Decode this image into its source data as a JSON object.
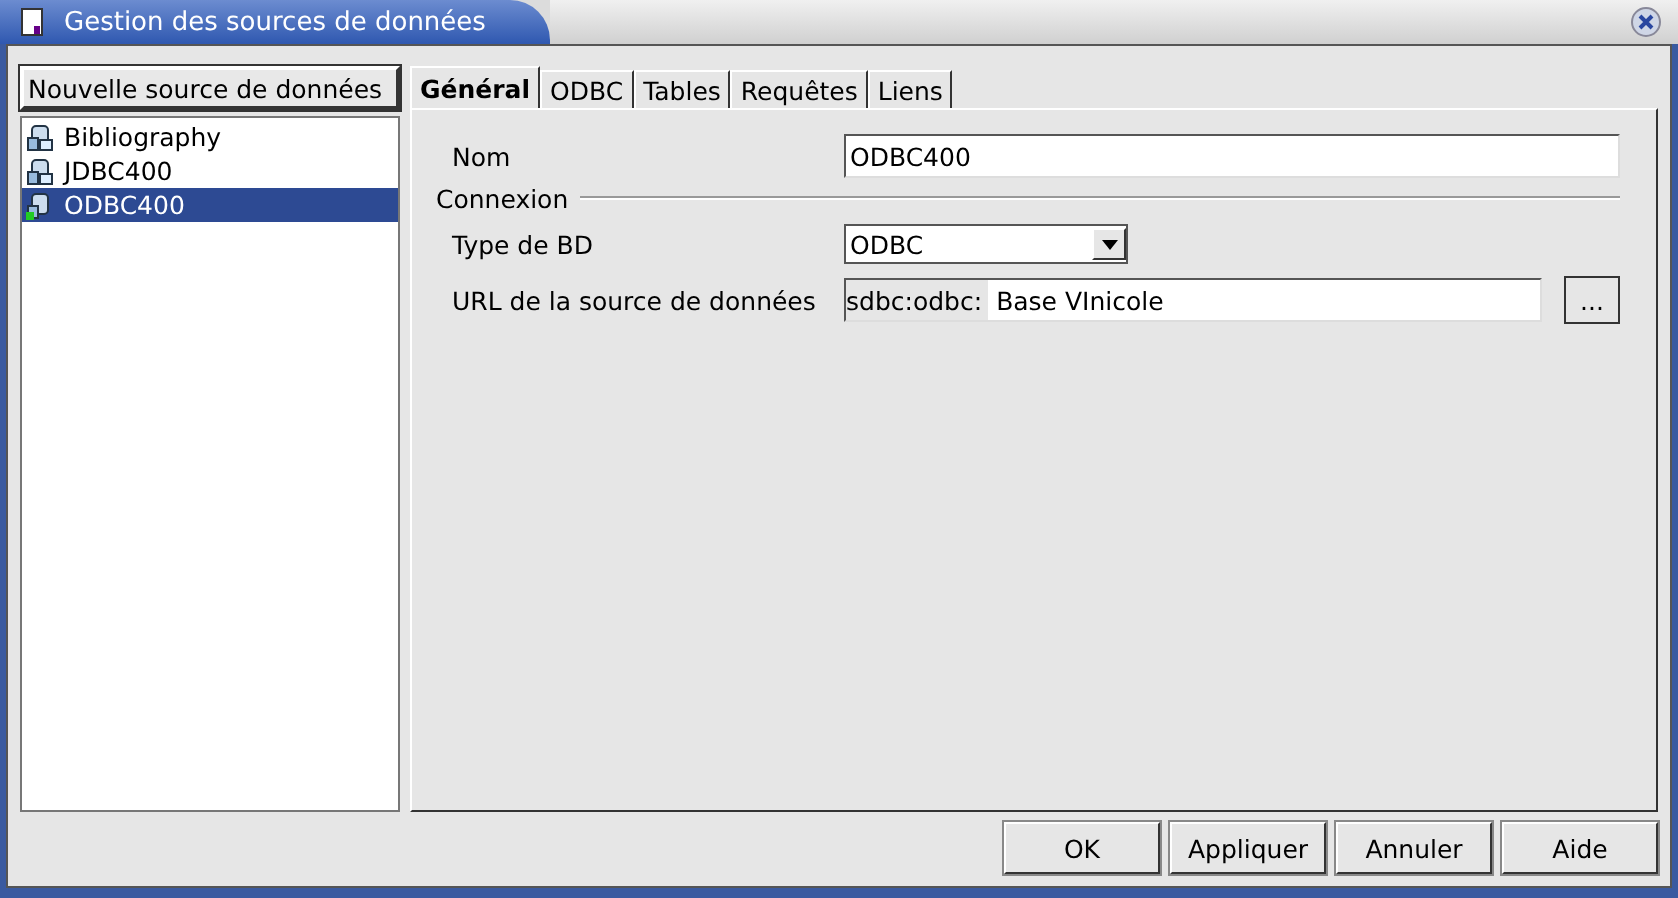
{
  "window": {
    "title": "Gestion des sources de données"
  },
  "new_source_button": "Nouvelle source de données",
  "sources": [
    {
      "label": "Bibliography",
      "kind": "database",
      "selected": false
    },
    {
      "label": "JDBC400",
      "kind": "database",
      "selected": false
    },
    {
      "label": "ODBC400",
      "kind": "odbc",
      "selected": true
    }
  ],
  "tabs": [
    {
      "label": "Général",
      "selected": true
    },
    {
      "label": "ODBC",
      "selected": false
    },
    {
      "label": "Tables",
      "selected": false
    },
    {
      "label": "Requêtes",
      "selected": false
    },
    {
      "label": "Liens",
      "selected": false
    }
  ],
  "name_field": {
    "label": "Nom",
    "value": "ODBC400"
  },
  "connection": {
    "title": "Connexion",
    "db_type": {
      "label": "Type de BD",
      "value": "ODBC"
    },
    "url": {
      "label": "URL de la source de données",
      "prefix": "sdbc:odbc:",
      "value": "Base VInicole",
      "browse": "..."
    }
  },
  "buttons": [
    "OK",
    "Appliquer",
    "Annuler",
    "Aide"
  ]
}
